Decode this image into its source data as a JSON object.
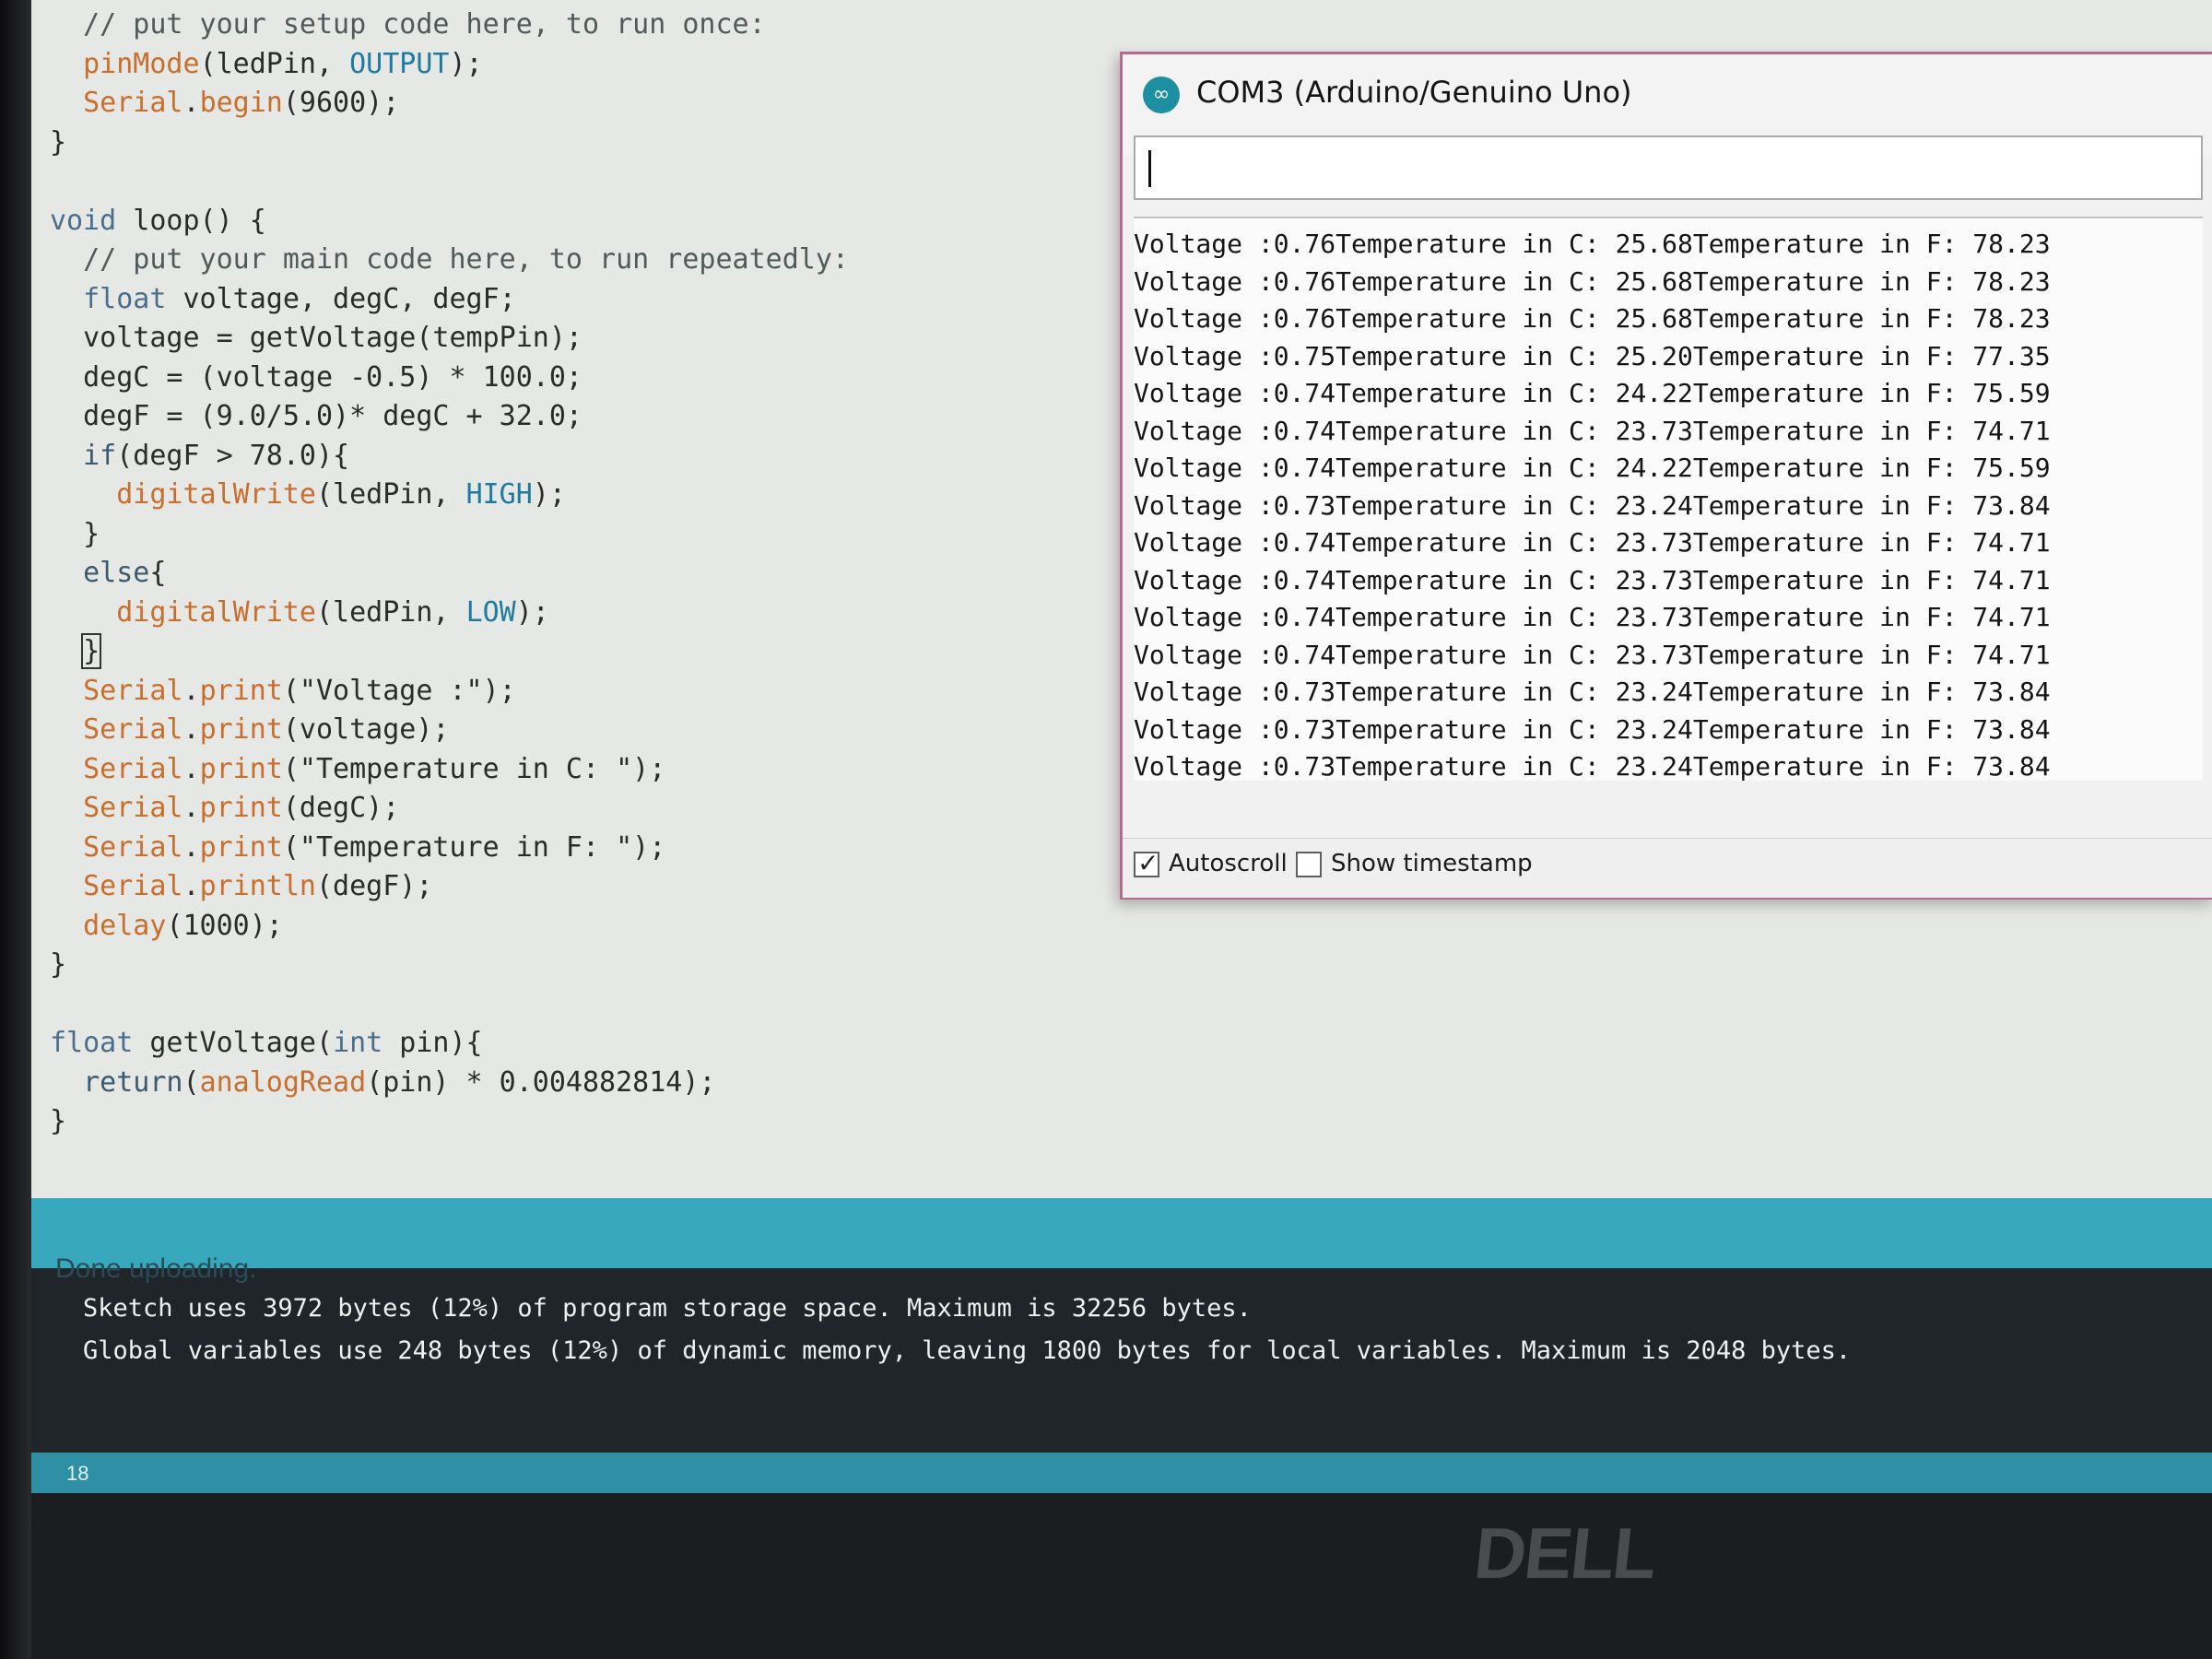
{
  "editor": {
    "lines": [
      [
        {
          "t": "  // put your setup code here, to run once:",
          "c": "c-comment"
        }
      ],
      [
        {
          "t": "  "
        },
        {
          "t": "pinMode",
          "c": "c-fn"
        },
        {
          "t": "(ledPin, "
        },
        {
          "t": "OUTPUT",
          "c": "c-const"
        },
        {
          "t": ");"
        }
      ],
      [
        {
          "t": "  "
        },
        {
          "t": "Serial",
          "c": "c-fn"
        },
        {
          "t": "."
        },
        {
          "t": "begin",
          "c": "c-fn"
        },
        {
          "t": "(9600);"
        }
      ],
      [
        {
          "t": "}"
        }
      ],
      [
        {
          "t": ""
        }
      ],
      [
        {
          "t": "void",
          "c": "c-type"
        },
        {
          "t": " loop() {"
        }
      ],
      [
        {
          "t": "  // put your main code here, to run repeatedly:",
          "c": "c-comment"
        }
      ],
      [
        {
          "t": "  "
        },
        {
          "t": "float",
          "c": "c-type"
        },
        {
          "t": " voltage, degC, degF;"
        }
      ],
      [
        {
          "t": "  voltage = getVoltage(tempPin);"
        }
      ],
      [
        {
          "t": "  degC = (voltage -0.5) * 100.0;"
        }
      ],
      [
        {
          "t": "  degF = (9.0/5.0)* degC + 32.0;"
        }
      ],
      [
        {
          "t": "  "
        },
        {
          "t": "if",
          "c": "c-kw"
        },
        {
          "t": "(degF > 78.0){"
        }
      ],
      [
        {
          "t": "    "
        },
        {
          "t": "digitalWrite",
          "c": "c-fn"
        },
        {
          "t": "(ledPin, "
        },
        {
          "t": "HIGH",
          "c": "c-const"
        },
        {
          "t": ");"
        }
      ],
      [
        {
          "t": "  }"
        }
      ],
      [
        {
          "t": "  "
        },
        {
          "t": "else",
          "c": "c-kw"
        },
        {
          "t": "{"
        }
      ],
      [
        {
          "t": "    "
        },
        {
          "t": "digitalWrite",
          "c": "c-fn"
        },
        {
          "t": "(ledPin, "
        },
        {
          "t": "LOW",
          "c": "c-const"
        },
        {
          "t": ");"
        }
      ],
      [
        {
          "t": "  "
        },
        {
          "t": "}",
          "c": "caret-box"
        }
      ],
      [
        {
          "t": "  "
        },
        {
          "t": "Serial",
          "c": "c-fn"
        },
        {
          "t": "."
        },
        {
          "t": "print",
          "c": "c-fn"
        },
        {
          "t": "(\"Voltage :\");"
        }
      ],
      [
        {
          "t": "  "
        },
        {
          "t": "Serial",
          "c": "c-fn"
        },
        {
          "t": "."
        },
        {
          "t": "print",
          "c": "c-fn"
        },
        {
          "t": "(voltage);"
        }
      ],
      [
        {
          "t": "  "
        },
        {
          "t": "Serial",
          "c": "c-fn"
        },
        {
          "t": "."
        },
        {
          "t": "print",
          "c": "c-fn"
        },
        {
          "t": "(\"Temperature in C: \");"
        }
      ],
      [
        {
          "t": "  "
        },
        {
          "t": "Serial",
          "c": "c-fn"
        },
        {
          "t": "."
        },
        {
          "t": "print",
          "c": "c-fn"
        },
        {
          "t": "(degC);"
        }
      ],
      [
        {
          "t": "  "
        },
        {
          "t": "Serial",
          "c": "c-fn"
        },
        {
          "t": "."
        },
        {
          "t": "print",
          "c": "c-fn"
        },
        {
          "t": "(\"Temperature in F: \");"
        }
      ],
      [
        {
          "t": "  "
        },
        {
          "t": "Serial",
          "c": "c-fn"
        },
        {
          "t": "."
        },
        {
          "t": "println",
          "c": "c-fn"
        },
        {
          "t": "(degF);"
        }
      ],
      [
        {
          "t": "  "
        },
        {
          "t": "delay",
          "c": "c-fn"
        },
        {
          "t": "(1000);"
        }
      ],
      [
        {
          "t": "}"
        }
      ],
      [
        {
          "t": ""
        }
      ],
      [
        {
          "t": "float",
          "c": "c-type"
        },
        {
          "t": " getVoltage("
        },
        {
          "t": "int",
          "c": "c-type"
        },
        {
          "t": " pin){"
        }
      ],
      [
        {
          "t": "  "
        },
        {
          "t": "return",
          "c": "c-kw"
        },
        {
          "t": "("
        },
        {
          "t": "analogRead",
          "c": "c-fn"
        },
        {
          "t": "(pin) * 0.004882814);"
        }
      ],
      [
        {
          "t": "}"
        }
      ]
    ]
  },
  "status": {
    "message": "Done uploading."
  },
  "console": {
    "line1": "Sketch uses 3972 bytes (12%) of program storage space. Maximum is 32256 bytes.",
    "line2": "Global variables use 248 bytes (12%) of dynamic memory, leaving 1800 bytes for local variables. Maximum is 2048 bytes."
  },
  "line_number": "18",
  "serial_monitor": {
    "title": "COM3 (Arduino/Genuino Uno)",
    "input_value": "",
    "output_rows": [
      "Voltage :0.76Temperature in C: 25.68Temperature in F: 78.23",
      "Voltage :0.76Temperature in C: 25.68Temperature in F: 78.23",
      "Voltage :0.76Temperature in C: 25.68Temperature in F: 78.23",
      "Voltage :0.75Temperature in C: 25.20Temperature in F: 77.35",
      "Voltage :0.74Temperature in C: 24.22Temperature in F: 75.59",
      "Voltage :0.74Temperature in C: 23.73Temperature in F: 74.71",
      "Voltage :0.74Temperature in C: 24.22Temperature in F: 75.59",
      "Voltage :0.73Temperature in C: 23.24Temperature in F: 73.84",
      "Voltage :0.74Temperature in C: 23.73Temperature in F: 74.71",
      "Voltage :0.74Temperature in C: 23.73Temperature in F: 74.71",
      "Voltage :0.74Temperature in C: 23.73Temperature in F: 74.71",
      "Voltage :0.74Temperature in C: 23.73Temperature in F: 74.71",
      "Voltage :0.73Temperature in C: 23.24Temperature in F: 73.84",
      "Voltage :0.73Temperature in C: 23.24Temperature in F: 73.84",
      "Voltage :0.73Temperature in C: 23.24Temperature in F: 73.84"
    ],
    "autoscroll": {
      "label": "Autoscroll",
      "checked": true
    },
    "timestamp": {
      "label": "Show timestamp",
      "checked": false
    }
  },
  "bezel": {
    "brand": "DELL"
  },
  "colors": {
    "status_bar": "#38a9bd",
    "console_bg": "#1f2529",
    "window_border": "#b86a8c",
    "syntax_function": "#c96e2c"
  }
}
